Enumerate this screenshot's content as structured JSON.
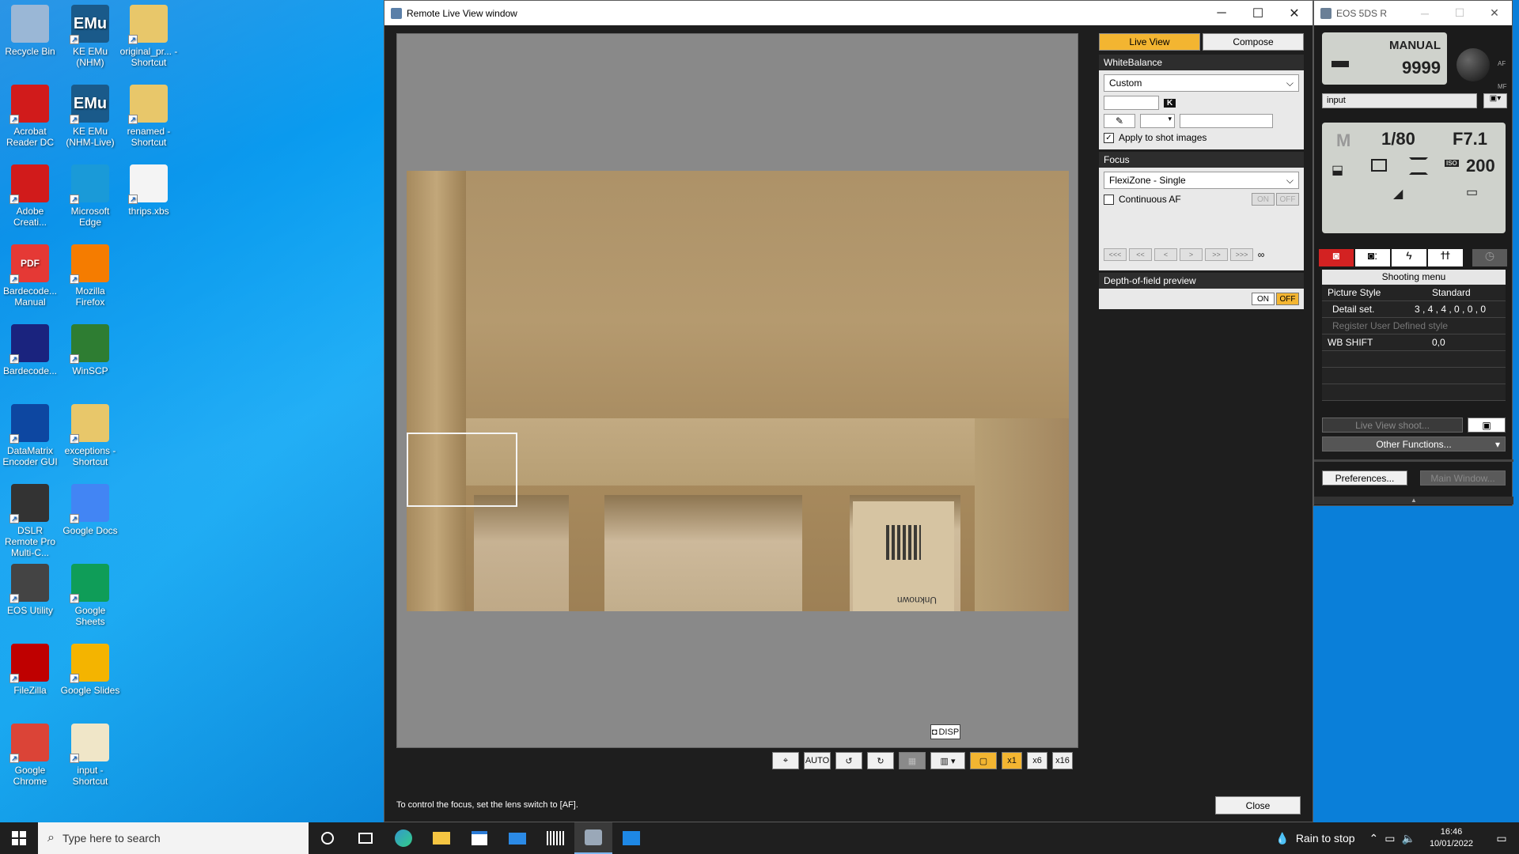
{
  "desktop": {
    "icons": [
      {
        "label": "Recycle Bin",
        "icon": "recycle-bin-icon",
        "color": "#9ab7d6"
      },
      {
        "label": "KE EMu (NHM)",
        "icon": "emu-icon",
        "color": "#1a5a8a",
        "glyph": "EMu"
      },
      {
        "label": "original_pr... - Shortcut",
        "icon": "folder-icon",
        "color": "#e8c76a"
      },
      {
        "label": "Acrobat Reader DC",
        "icon": "acrobat-icon",
        "color": "#d11b1b"
      },
      {
        "label": "KE EMu (NHM-Live)",
        "icon": "emu-icon",
        "color": "#1a5a8a",
        "glyph": "EMu"
      },
      {
        "label": "renamed - Shortcut",
        "icon": "folder-icon",
        "color": "#e8c76a"
      },
      {
        "label": "Adobe Creati...",
        "icon": "creative-cloud-icon",
        "color": "#d11b1b"
      },
      {
        "label": "Microsoft Edge",
        "icon": "edge-icon",
        "color": "#1a9ad8"
      },
      {
        "label": "thrips.xbs",
        "icon": "file-icon",
        "color": "#f4f4f4"
      },
      {
        "label": "Bardecode... Manual",
        "icon": "pdf-icon",
        "color": "#e53935",
        "glyph": "PDF"
      },
      {
        "label": "Mozilla Firefox",
        "icon": "firefox-icon",
        "color": "#f57c00"
      },
      {
        "label": "Bardecode...",
        "icon": "barcode-icon",
        "color": "#1a237e"
      },
      {
        "label": "WinSCP",
        "icon": "winscp-icon",
        "color": "#2e7d32"
      },
      {
        "label": "DataMatrix Encoder GUI",
        "icon": "datamatrix-icon",
        "color": "#0d47a1"
      },
      {
        "label": "exceptions - Shortcut",
        "icon": "folder-icon",
        "color": "#e8c76a"
      },
      {
        "label": "DSLR Remote Pro Multi-C...",
        "icon": "camera-icon",
        "color": "#333333"
      },
      {
        "label": "Google Docs",
        "icon": "google-docs-icon",
        "color": "#4285f4"
      },
      {
        "label": "EOS Utility",
        "icon": "eos-utility-icon",
        "color": "#444444"
      },
      {
        "label": "Google Sheets",
        "icon": "google-sheets-icon",
        "color": "#0f9d58"
      },
      {
        "label": "FileZilla",
        "icon": "filezilla-icon",
        "color": "#bf0000"
      },
      {
        "label": "Google Slides",
        "icon": "google-slides-icon",
        "color": "#f4b400"
      },
      {
        "label": "Google Chrome",
        "icon": "chrome-icon",
        "color": "#db4437"
      },
      {
        "label": "input - Shortcut",
        "icon": "file-icon",
        "color": "#f0e6c8"
      }
    ]
  },
  "liveview": {
    "title": "Remote Live View window",
    "disp_label": "DISP",
    "status": "To control the focus, set the lens switch to [AF].",
    "close_label": "Close",
    "tools": [
      "⌖",
      "AUTO",
      "↺",
      "↻",
      "▦",
      "▥ ▾",
      "▢",
      "x1",
      "x6",
      "x16"
    ],
    "image_label": "Unknown",
    "mode_buttons": {
      "live_view": "Live View",
      "compose": "Compose"
    },
    "white_balance": {
      "header": "WhiteBalance",
      "value": "Custom",
      "k_label": "K",
      "apply_label": "Apply to shot images",
      "apply_checked": true
    },
    "focus": {
      "header": "Focus",
      "mode": "FlexiZone - Single",
      "continuous_label": "Continuous AF",
      "on": "ON",
      "off": "OFF",
      "nav": [
        "<<<",
        "<<",
        "<",
        ">",
        ">>",
        ">>>",
        "∞"
      ]
    },
    "dof": {
      "header": "Depth-of-field preview",
      "on": "ON",
      "off": "OFF"
    }
  },
  "eos": {
    "title": "EOS 5DS R",
    "lcd_mode": "MANUAL",
    "lcd_count": "9999",
    "af_label": "AF",
    "mf_label": "MF",
    "input_value": "input",
    "settings": {
      "mode": "M",
      "shutter": "1/80",
      "aperture": "F7.1",
      "iso_label": "ISO",
      "iso": "200"
    },
    "menu_header": "Shooting menu",
    "menu_rows": [
      {
        "key": "Picture Style",
        "value": "Standard",
        "disabled": false
      },
      {
        "key": "Detail set.",
        "value": "3 , 4 , 4 , 0 , 0 , 0",
        "disabled": false
      },
      {
        "key": "Register User Defined style",
        "value": "",
        "disabled": true
      },
      {
        "key": "WB SHIFT",
        "value": "0,0",
        "disabled": false
      },
      {
        "key": "",
        "value": "",
        "disabled": false
      },
      {
        "key": "",
        "value": "",
        "disabled": false
      },
      {
        "key": "",
        "value": "",
        "disabled": false
      }
    ],
    "liveview_shoot": "Live View shoot...",
    "other_functions": "Other Functions...",
    "preferences": "Preferences...",
    "main_window": "Main Window..."
  },
  "taskbar": {
    "search_placeholder": "Type here to search",
    "weather": "Rain to stop",
    "time": "16:46",
    "date": "10/01/2022"
  }
}
